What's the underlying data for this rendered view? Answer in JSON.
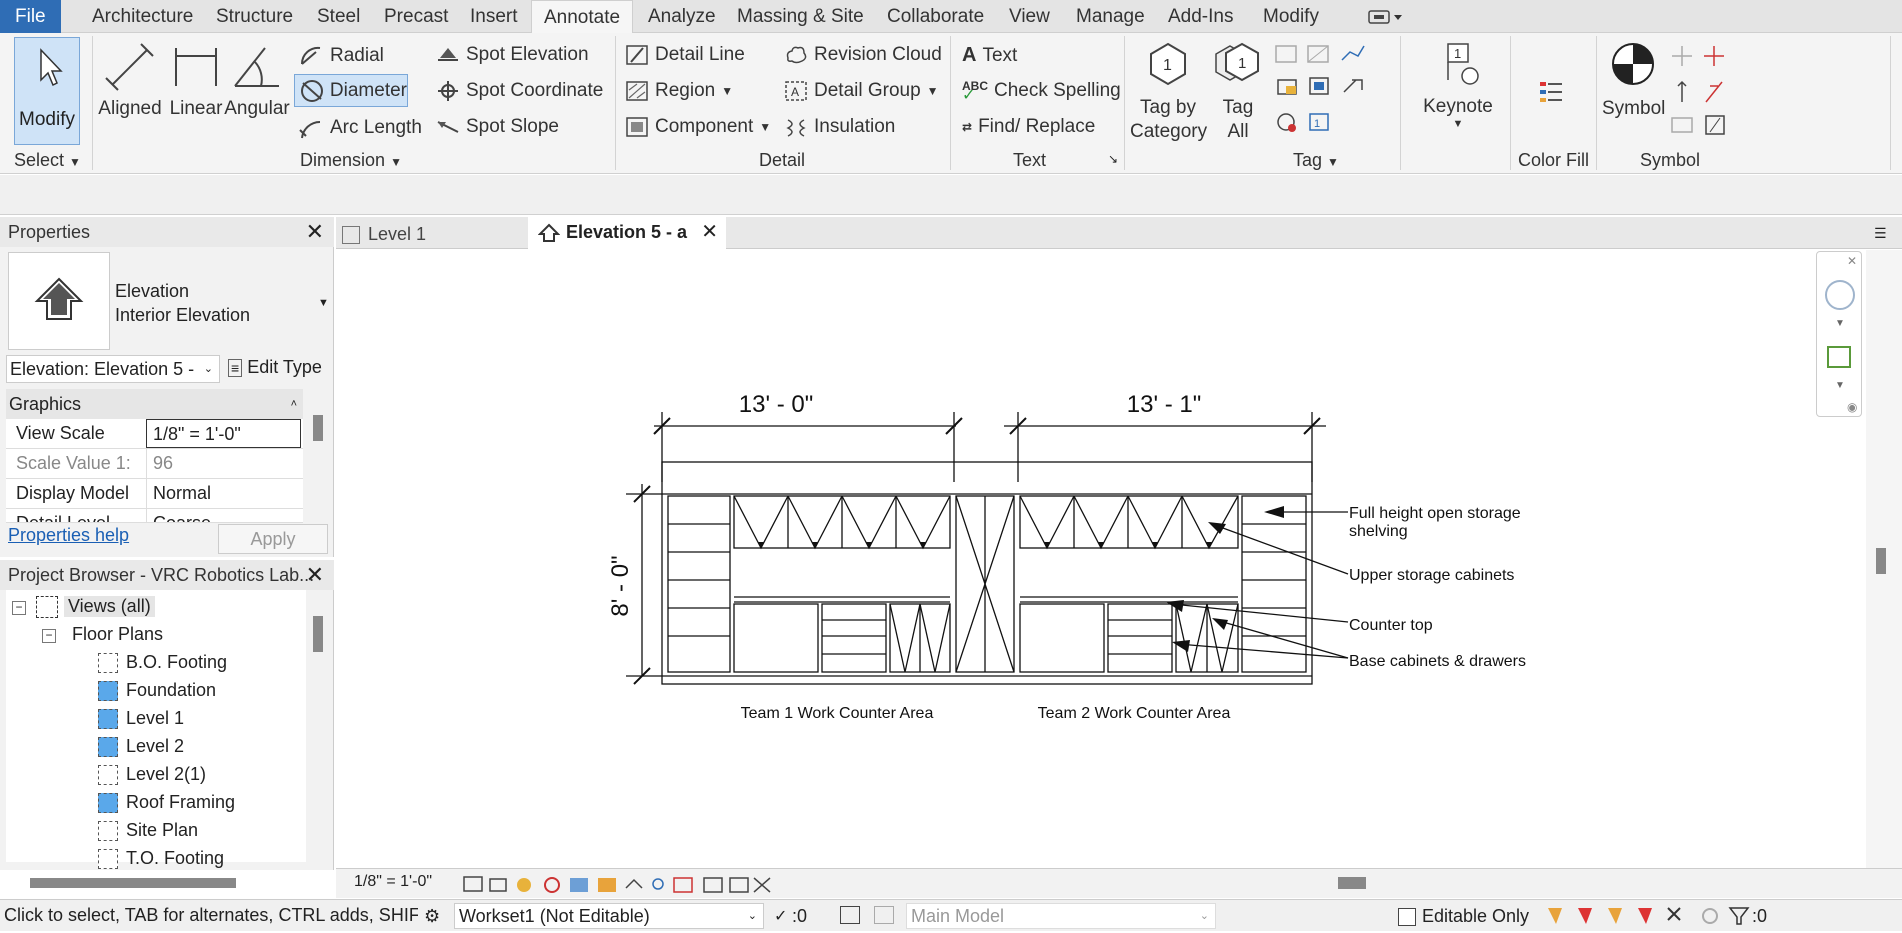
{
  "ribbon_tabs": [
    "File",
    "Architecture",
    "Structure",
    "Steel",
    "Precast",
    "Insert",
    "Annotate",
    "Analyze",
    "Massing & Site",
    "Collaborate",
    "View",
    "Manage",
    "Add-Ins",
    "Modify"
  ],
  "active_tab": "Annotate",
  "ribbon": {
    "modify_label": "Modify",
    "select_panel": "Select",
    "aligned": "Aligned",
    "linear": "Linear",
    "angular": "Angular",
    "radial": "Radial",
    "diameter": "Diameter",
    "arc_length": "Arc  Length",
    "spot_elevation": "Spot  Elevation",
    "spot_coordinate": "Spot  Coordinate",
    "spot_slope": "Spot  Slope",
    "dimension_panel": "Dimension",
    "detail_line": "Detail  Line",
    "region": "Region",
    "component": "Component",
    "revision_cloud": "Revision  Cloud",
    "detail_group": "Detail  Group",
    "insulation": "Insulation",
    "detail_panel": "Detail",
    "text": "Text",
    "check_spelling": "Check  Spelling",
    "find_replace": "Find/  Replace",
    "text_panel": "Text",
    "tag_by_category_1": "Tag by",
    "tag_by_category_2": "Category",
    "tag_all_1": "Tag",
    "tag_all_2": "All",
    "tag_panel": "Tag",
    "keynote": "Keynote",
    "color_fill_panel": "Color Fill",
    "symbol": "Symbol",
    "symbol_panel": "Symbol"
  },
  "properties": {
    "title": "Properties",
    "type_line1": "Elevation",
    "type_line2": "Interior Elevation",
    "selector": "Elevation: Elevation 5 -",
    "edit_type": "Edit Type",
    "graphics_header": "Graphics",
    "rows": [
      {
        "key": "View Scale",
        "value": "1/8\" = 1'-0\""
      },
      {
        "key": "Scale Value    1:",
        "value": "96"
      },
      {
        "key": "Display Model",
        "value": "Normal"
      },
      {
        "key": "Detail Level",
        "value": "Coarse"
      }
    ],
    "help_link": "Properties help",
    "apply": "Apply"
  },
  "browser": {
    "title": "Project Browser - VRC Robotics Lab...",
    "views_all": "Views (all)",
    "floor_plans": "Floor Plans",
    "items": [
      {
        "name": "B.O. Footing",
        "filled": false
      },
      {
        "name": "Foundation",
        "filled": true
      },
      {
        "name": "Level 1",
        "filled": true
      },
      {
        "name": "Level 2",
        "filled": true
      },
      {
        "name": "Level 2(1)",
        "filled": false
      },
      {
        "name": "Roof Framing",
        "filled": true
      },
      {
        "name": "Site Plan",
        "filled": false
      },
      {
        "name": "T.O. Footing",
        "filled": false
      }
    ]
  },
  "view_tabs": [
    {
      "label": "Level 1",
      "active": false
    },
    {
      "label": "Elevation 5 - a",
      "active": true
    }
  ],
  "drawing": {
    "dim_left": "13' - 0\"",
    "dim_right": "13' - 1\"",
    "dim_height": "8' - 0\"",
    "callouts": [
      "Full height open storage",
      "shelving",
      "Upper storage cabinets",
      "Counter top",
      "Base cabinets & drawers"
    ],
    "label_team1": "Team 1 Work Counter Area",
    "label_team2": "Team 2 Work Counter Area"
  },
  "view_control": {
    "scale": "1/8\" = 1'-0\""
  },
  "status": {
    "hint": "Click to select, TAB for alternates, CTRL adds, SHIFT u",
    "workset": "Workset1 (Not Editable)",
    "count": ":0",
    "model": "Main Model",
    "editable_only": "Editable Only",
    "filter_count": ":0"
  },
  "colors": {
    "accent": "#2f6db5",
    "highlight": "#cfe3f7"
  }
}
